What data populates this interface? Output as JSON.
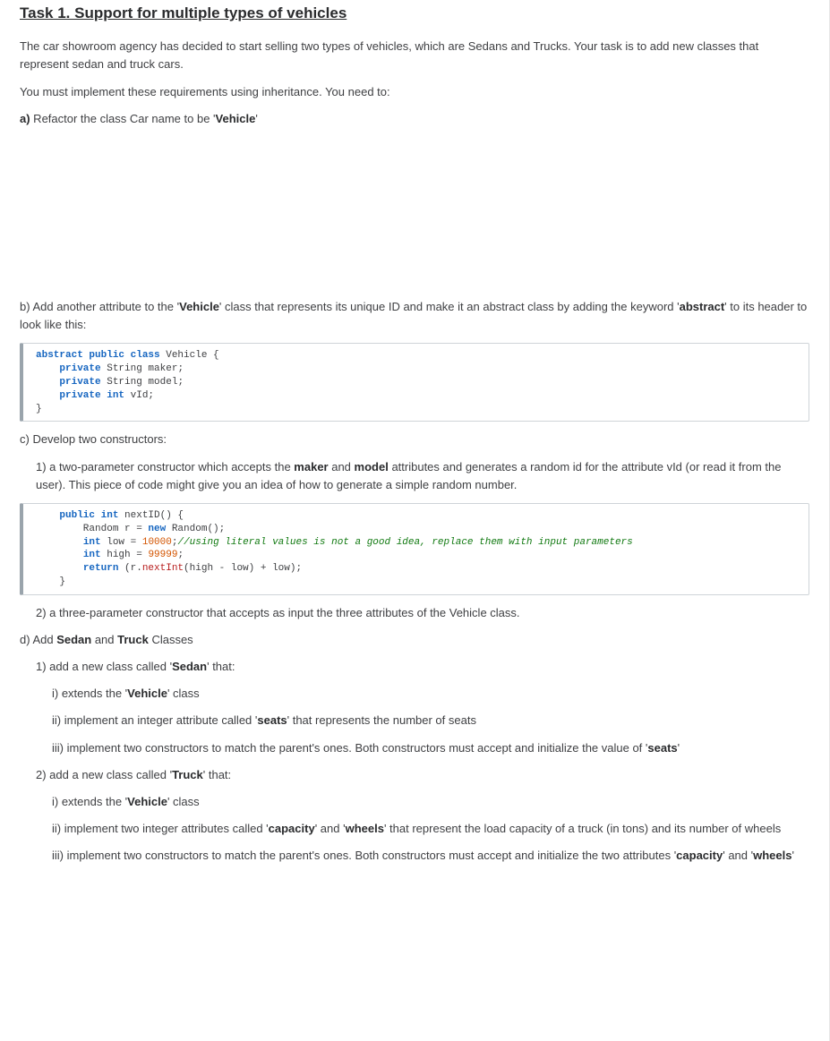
{
  "title": "Task 1. Support for multiple types of vehicles",
  "intro": "The car showroom agency has decided to start selling two types of vehicles, which are Sedans and Trucks.  Your task is to add new classes that represent sedan and truck cars.",
  "intro2": "You must implement these requirements using inheritance. You need to:",
  "a": {
    "prefix": "a)",
    "text": " Refactor the class Car name to be '",
    "bold": "Vehicle",
    "suffix": "'"
  },
  "b": {
    "pre1": "b) Add another attribute to the '",
    "b1": "Vehicle",
    "mid": "' class that represents its unique ID and make it an abstract class by adding the keyword '",
    "b2": "abstract",
    "post": "' to its header to look like this:"
  },
  "code1": {
    "l1a": "abstract public class",
    "l1b": " Vehicle {",
    "l2a": "private",
    "l2b": " String maker;",
    "l3a": "private",
    "l3b": " String model;",
    "l4a": "private int",
    "l4b": " vId;",
    "l5": "}"
  },
  "c": "c) Develop two constructors:",
  "c1a": "1) a two-parameter constructor which accepts the ",
  "c1b1": "maker",
  "c1mid": " and ",
  "c1b2": "model",
  "c1c": " attributes and generates a random id for the attribute vId (or read it from the user). This piece of code might give you an idea of how to generate a simple random number.",
  "code2": {
    "l1a": "public int",
    "l1b": " nextID() {",
    "l2a": "        Random r = ",
    "l2new": "new",
    "l2b": " Random();",
    "l3a": "        ",
    "l3kw": "int",
    "l3b": " low = ",
    "l3lit": "10000",
    "l3c": ";",
    "l3comm": "//using literal values is not a good idea, replace them with input parameters",
    "l4a": "        ",
    "l4kw": "int",
    "l4b": " high = ",
    "l4lit": "99999",
    "l4c": ";",
    "l5a": "        ",
    "l5kw": "return",
    "l5b": " (r.",
    "l5call": "nextInt",
    "l5c": "(high - low) + low);",
    "l6": "    }"
  },
  "c2": "2) a three-parameter constructor that accepts as input the three attributes of the Vehicle class.",
  "d": {
    "pre": "d) Add ",
    "b1": "Sedan",
    "mid": " and ",
    "b2": "Truck",
    "post": " Classes"
  },
  "d1": {
    "pre": "1) add a new class called '",
    "b": "Sedan",
    "post": "' that:"
  },
  "d1i": {
    "pre": "i) extends the '",
    "b": "Vehicle",
    "post": "' class"
  },
  "d1ii": {
    "pre": "ii) implement an integer attribute called '",
    "b": "seats",
    "post": "' that represents the number of seats"
  },
  "d1iii": {
    "pre": "iii) implement two constructors to match the parent's ones. Both constructors must accept and initialize the value of '",
    "b": "seats",
    "post": "'"
  },
  "d2": {
    "pre": "2) add a new class called '",
    "b": "Truck",
    "post": "' that:"
  },
  "d2i": {
    "pre": "i) extends the '",
    "b": "Vehicle",
    "post": "' class"
  },
  "d2ii": {
    "pre": "ii) implement two integer attributes called '",
    "b1": "capacity",
    "mid": "' and '",
    "b2": "wheels",
    "post": "' that represent the load capacity of a truck (in tons) and its number of wheels"
  },
  "d2iii": {
    "pre": "iii) implement two constructors to match the parent's ones. Both constructors must accept and initialize the two attributes '",
    "b1": "capacity",
    "mid": "' and '",
    "b2": "wheels",
    "post": "'"
  }
}
